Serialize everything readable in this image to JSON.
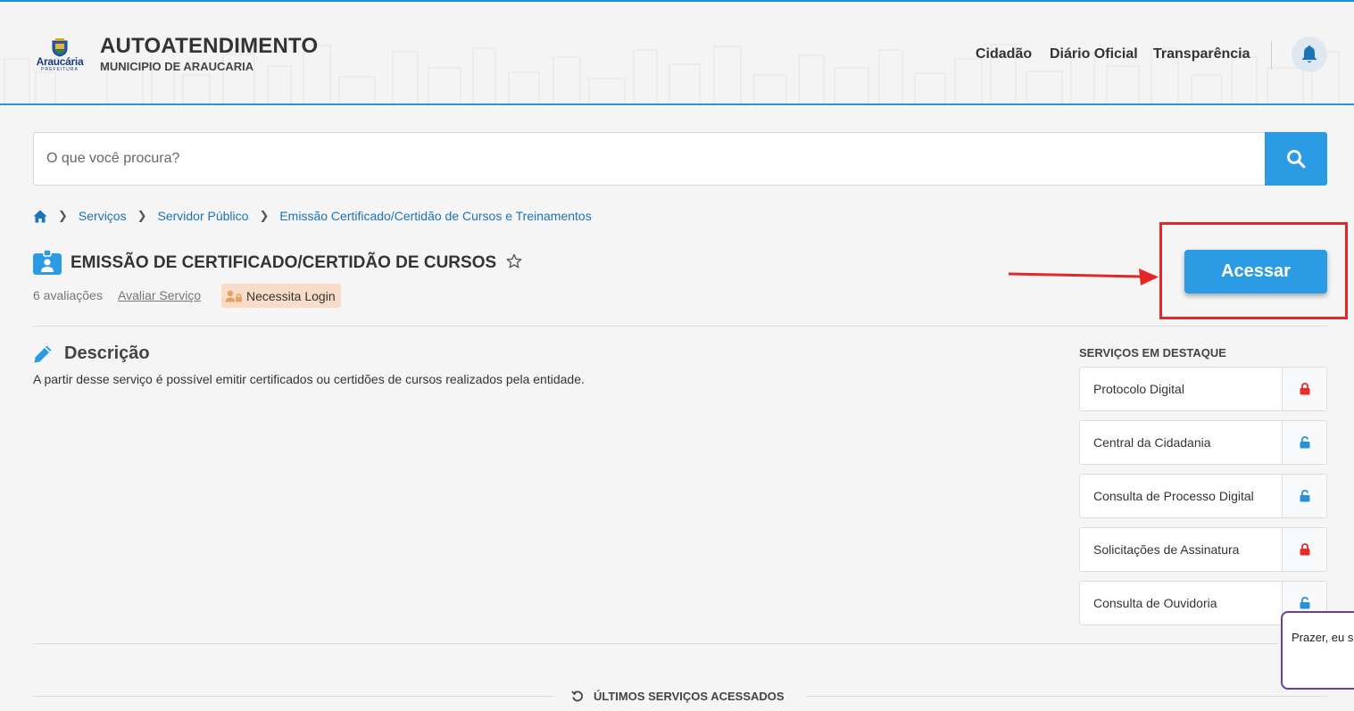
{
  "header": {
    "logo_text": "Araucária",
    "logo_subtext": "PREFEITURA",
    "title": "AUTOATENDIMENTO",
    "subtitle": "MUNICIPIO DE ARAUCARIA",
    "nav": [
      "Cidadão",
      "Diário Oficial",
      "Transparência"
    ],
    "notifications_icon": "bell-icon"
  },
  "search": {
    "placeholder": "O que você procura?",
    "value": "",
    "button_icon": "search-icon"
  },
  "breadcrumb": {
    "home_icon": "home-icon",
    "items": [
      "Serviços",
      "Servidor Público",
      "Emissão Certificado/Certidão de Cursos e Treinamentos"
    ]
  },
  "service": {
    "title": "EMISSÃO DE CERTIFICADO/CERTIDÃO DE CURSOS",
    "ratings": "6 avaliações",
    "rate_link": "Avaliar Serviço",
    "login_badge": "Necessita Login",
    "access_button": "Acessar"
  },
  "description": {
    "title": "Descrição",
    "text": "A partir desse serviço é possível emitir certificados ou certidões de cursos realizados pela entidade."
  },
  "featured": {
    "title": "SERVIÇOS EM DESTAQUE",
    "items": [
      {
        "label": "Protocolo Digital",
        "lock": "locked"
      },
      {
        "label": "Central da Cidadania",
        "lock": "unlocked"
      },
      {
        "label": "Consulta de Processo Digital",
        "lock": "unlocked"
      },
      {
        "label": "Solicitações de Assinatura",
        "lock": "locked"
      },
      {
        "label": "Consulta de Ouvidoria",
        "lock": "unlocked"
      }
    ]
  },
  "recent": {
    "title": "ÚLTIMOS SERVIÇOS ACESSADOS"
  },
  "chat": {
    "text": "Prazer, eu s"
  },
  "colors": {
    "accent": "#2b9ce4",
    "link": "#1b74b8",
    "locked": "#e82b2b",
    "unlocked": "#2b8fd8",
    "highlight": "#e32626",
    "badge_bg": "#f8dcc8"
  }
}
